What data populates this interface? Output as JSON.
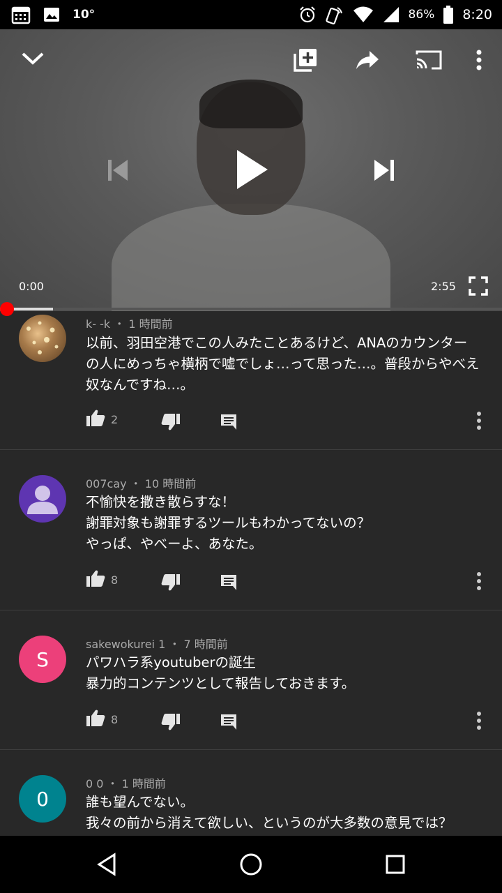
{
  "status_bar": {
    "temperature": "10°",
    "battery": "86%",
    "time": "8:20"
  },
  "player": {
    "current_time": "0:00",
    "duration": "2:55",
    "progress": 0.0
  },
  "comments": [
    {
      "author": "k- -k",
      "time": "1 時間前",
      "lines": [
        "以前、羽田空港でこの人みたことあるけど、ANAのカウンター",
        "の人にめっちゃ横柄で嘘でしょ…って思った…。普段からやべえ",
        "奴なんですね…。"
      ],
      "likes": "2",
      "avatar_letter": "",
      "avatar_color": "#8a6a44"
    },
    {
      "author": "007cay",
      "time": "10 時間前",
      "lines": [
        "不愉快を撒き散らすな！",
        "謝罪対象も謝罪するツールもわかってないの？",
        "やっぱ、やべーよ、あなた。"
      ],
      "likes": "8",
      "avatar_letter": "",
      "avatar_color": "#5e35b1"
    },
    {
      "author": "sakewokurei 1",
      "time": "7 時間前",
      "lines": [
        "パワハラ系youtuberの誕生",
        "暴力的コンテンツとして報告しておきます。"
      ],
      "likes": "8",
      "avatar_letter": "S",
      "avatar_color": "#ec407a"
    },
    {
      "author": "0 0",
      "time": "1 時間前",
      "lines": [
        "誰も望んでない。",
        "我々の前から消えて欲しい、というのが大多数の意見では？"
      ],
      "likes": "",
      "avatar_letter": "0",
      "avatar_color": "#00838f"
    }
  ],
  "colors": {
    "background": "#282828",
    "seek_red": "#ff0000",
    "meta_text": "#aaaaaa"
  }
}
